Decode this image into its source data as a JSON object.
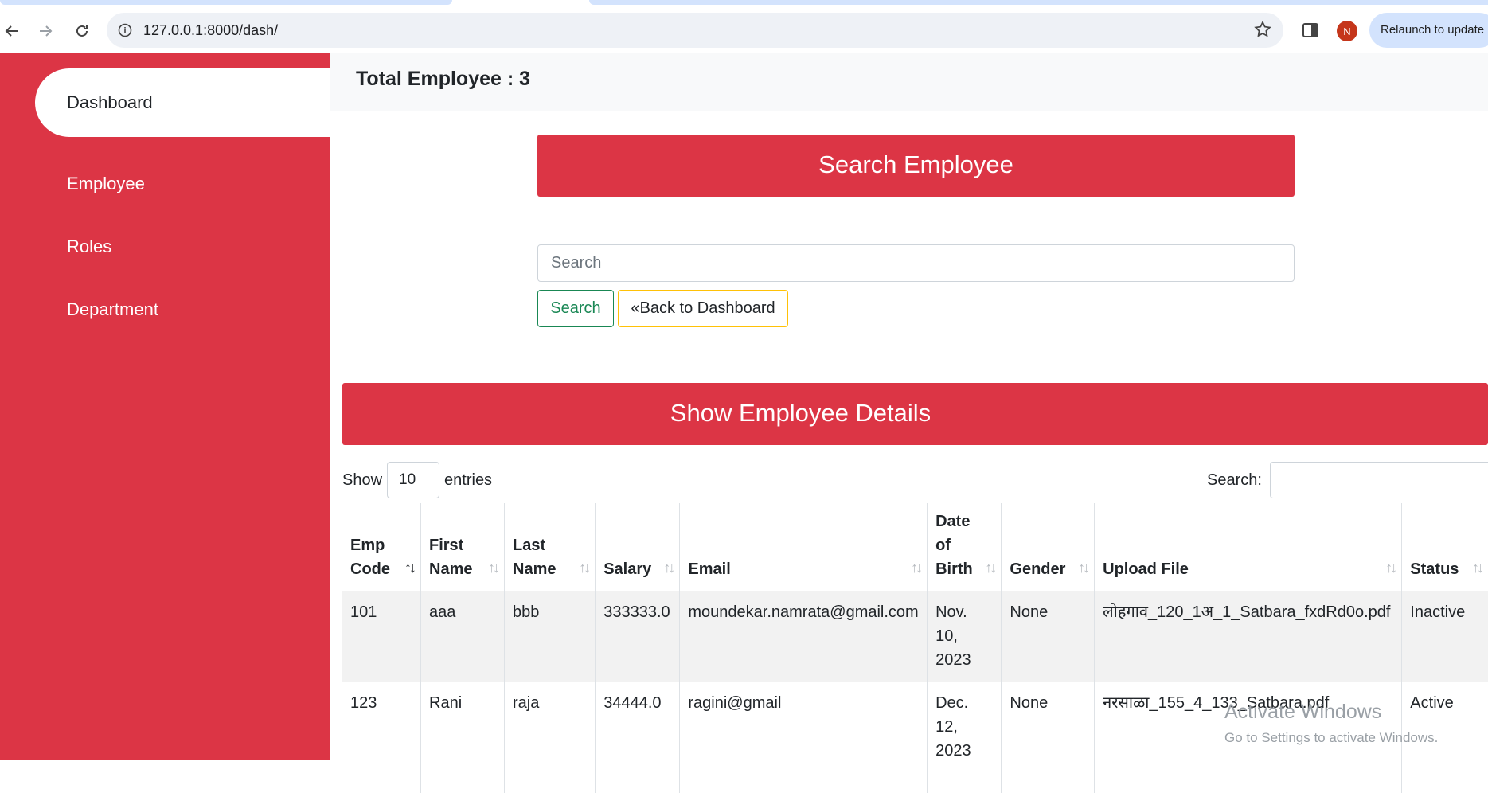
{
  "browser": {
    "url": "127.0.0.1:8000/dash/",
    "profile_initial": "N",
    "relaunch_label": "Relaunch to update"
  },
  "sidebar": {
    "items": [
      {
        "label": "Dashboard",
        "active": true
      },
      {
        "label": "Employee"
      },
      {
        "label": "Roles"
      },
      {
        "label": "Department"
      }
    ]
  },
  "header": {
    "total_label": "Total Employee : 3"
  },
  "search_section": {
    "title": "Search Employee",
    "input_placeholder": "Search",
    "search_button": "Search",
    "back_button": "«Back to Dashboard"
  },
  "details_section": {
    "title": "Show Employee Details",
    "show_label": "Show",
    "entries_value": "10",
    "entries_label": "entries",
    "search_label": "Search:"
  },
  "table": {
    "columns": [
      "Emp Code",
      "First Name",
      "Last Name",
      "Salary",
      "Email",
      "Date of Birth",
      "Gender",
      "Upload File",
      "Status"
    ],
    "rows": [
      [
        "101",
        "aaa",
        "bbb",
        "333333.0",
        "moundekar.namrata@gmail.com",
        "Nov. 10, 2023",
        "None",
        "लोहगाव_120_1अ_1_Satbara_fxdRd0o.pdf",
        "Inactive"
      ],
      [
        "123",
        "Rani",
        "raja",
        "34444.0",
        "ragini@gmail",
        "Dec. 12, 2023",
        "None",
        "नरसाळा_155_4_133_Satbara.pdf",
        "Active"
      ]
    ]
  },
  "watermark": {
    "line1": "Activate Windows",
    "line2": "Go to Settings to activate Windows."
  },
  "colors": {
    "accent": "#dc3545",
    "success": "#198754",
    "warning": "#ffc107"
  }
}
